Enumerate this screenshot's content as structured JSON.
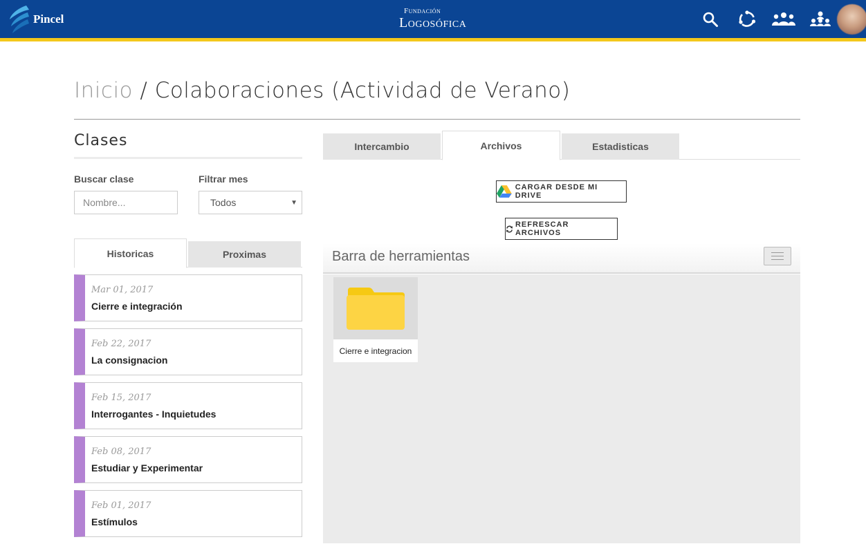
{
  "header": {
    "brand_name": "Pincel",
    "center_logo_line1": "Fundación",
    "center_logo_line2": "Logosófica",
    "icons": [
      "search-icon",
      "sync-icon",
      "group-icon",
      "org-chart-icon"
    ],
    "colors": {
      "bar": "#0b4594",
      "stripe": "#f4c81c"
    }
  },
  "breadcrumb": {
    "home": "Inicio",
    "separator": " / ",
    "current": "Colaboraciones (Actividad de Verano)"
  },
  "left": {
    "title": "Clases",
    "search_label": "Buscar clase",
    "search_placeholder": "Nombre...",
    "filter_label": "Filtrar mes",
    "filter_value": "Todos",
    "tabs": [
      {
        "label": "Historicas",
        "active": true
      },
      {
        "label": "Proximas",
        "active": false
      }
    ],
    "classes": [
      {
        "date": "Mar 01, 2017",
        "title": "Cierre e integración"
      },
      {
        "date": "Feb 22, 2017",
        "title": "La consignacion"
      },
      {
        "date": "Feb 15, 2017",
        "title": "Interrogantes - Inquietudes"
      },
      {
        "date": "Feb 08, 2017",
        "title": "Estudiar y Experimentar"
      },
      {
        "date": "Feb 01, 2017",
        "title": "Estímulos"
      }
    ],
    "accent_color": "#b382d3"
  },
  "main": {
    "tabs": [
      {
        "label": "Intercambio",
        "active": false
      },
      {
        "label": "Archivos",
        "active": true
      },
      {
        "label": "Estadisticas",
        "active": false
      }
    ],
    "drive_button": "Cargar desde mi drive",
    "refresh_button": "Refrescar archivos",
    "toolbar_title": "Barra de herramientas",
    "files": [
      {
        "name": "Cierre e integracion",
        "type": "folder",
        "icon": "folder-icon"
      }
    ]
  }
}
